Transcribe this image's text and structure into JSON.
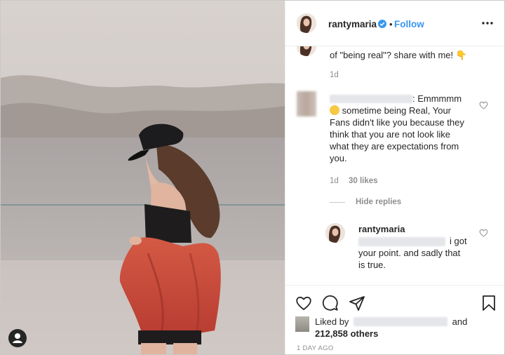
{
  "header": {
    "username": "rantymaria",
    "separator": "•",
    "follow_label": "Follow"
  },
  "comments": {
    "caption_text": "of \"being real\"? share with me! 👇",
    "caption_time": "1d",
    "comment1": {
      "line1_suffix": ": Emmmmm",
      "line2": "sometime being Real, Your",
      "line3": "Fans didn't like you because they",
      "line4": "think that you are not look like",
      "line5": "what they are expectations from",
      "line6": "you.",
      "time": "1d",
      "likes": "30 likes"
    },
    "hide_replies": "Hide replies",
    "reply": {
      "username": "rantymaria",
      "line1_suffix": "i got",
      "line2": "your point. and sadly that",
      "line3": "is true."
    }
  },
  "likes": {
    "prefix": "Liked by",
    "and": "and",
    "others": "212,858 others"
  },
  "timestamp": "1 DAY AGO",
  "colors": {
    "accent": "#3897f0",
    "jacket": "#c8493a",
    "sky": "#cfc7c2"
  }
}
